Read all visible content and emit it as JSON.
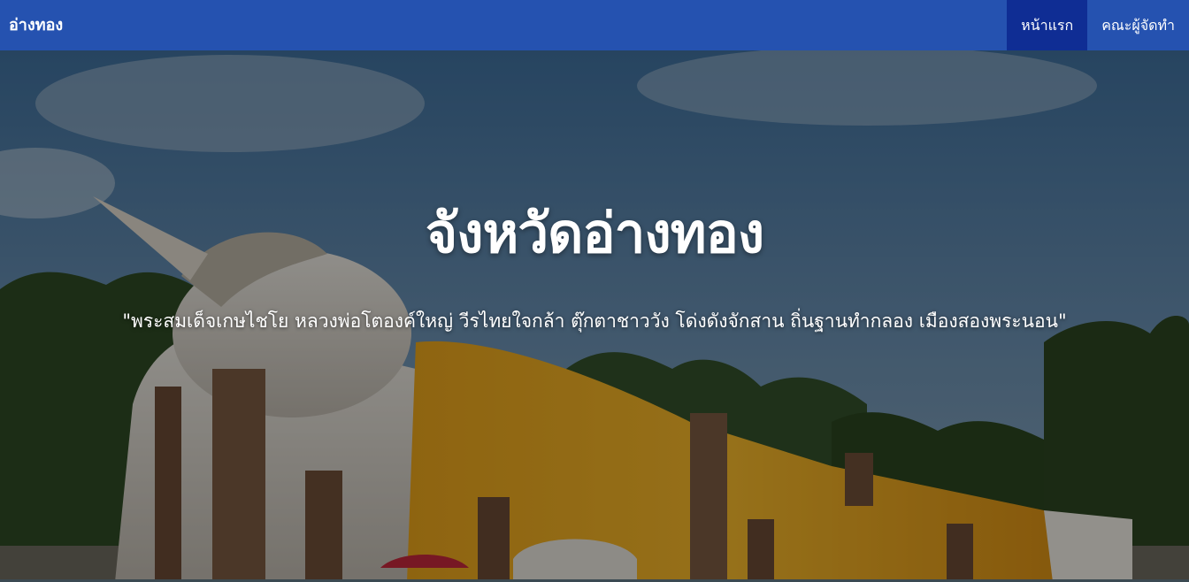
{
  "navbar": {
    "brand": "อ่างทอง",
    "items": [
      {
        "label": "หน้าแรก",
        "active": true
      },
      {
        "label": "คณะผู้จัดทำ",
        "active": false
      }
    ]
  },
  "hero": {
    "title": "จังหวัดอ่างทอง",
    "subtitle": "\"พระสมเด็จเกษไชโย หลวงพ่อโตองค์ใหญ่ วีรไทยใจกล้า ตุ๊กตาชาววัง โด่งดังจักสาน ถิ่นฐานทำกลอง เมืองสองพระนอน\""
  },
  "colors": {
    "navbar_bg": "#2552b0",
    "nav_active_bg": "#0f2d94",
    "text": "#ffffff"
  }
}
